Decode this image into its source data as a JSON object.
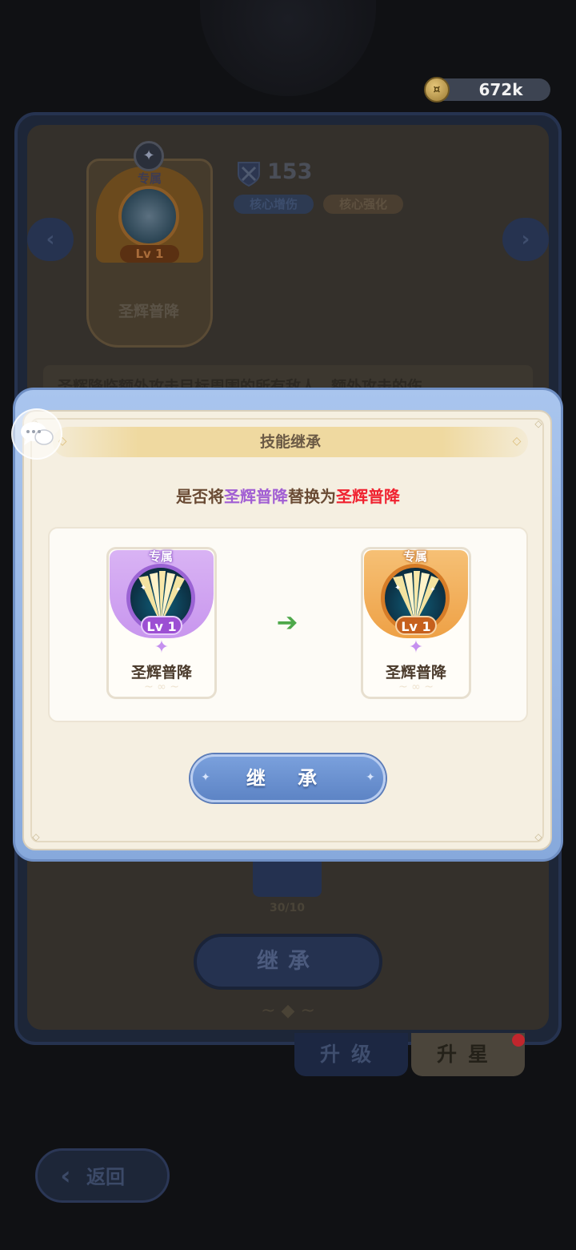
{
  "currency": {
    "amount": "672k",
    "icon": "coin-icon"
  },
  "background": {
    "skill_card": {
      "exclusive_label": "专属",
      "level": "Lv 1",
      "name": "圣辉普降"
    },
    "power": "153",
    "tags": [
      "核心增伤",
      "核心强化"
    ],
    "description": "圣辉降临额外攻击目标周围的所有敌人，额外攻击的伤",
    "material_count": "30/10",
    "inherit_button": "继承",
    "tabs": {
      "upgrade": "升级",
      "star": "升星"
    },
    "back_button": "返回"
  },
  "modal": {
    "title": "技能继承",
    "question": {
      "prefix": "是否将",
      "old_skill": "圣辉普降",
      "middle": "替换为",
      "new_skill": "圣辉普降"
    },
    "old_card": {
      "exclusive_label": "专属",
      "level": "Lv 1",
      "name": "圣辉普降"
    },
    "new_card": {
      "exclusive_label": "专属",
      "level": "Lv 1",
      "name": "圣辉普降"
    },
    "inherit_button": "继 承"
  },
  "colors": {
    "old_skill": "#a15ed3",
    "new_skill": "#f0212f",
    "modal_frame": "#87a9dc",
    "arrow": "#4ea84a"
  }
}
